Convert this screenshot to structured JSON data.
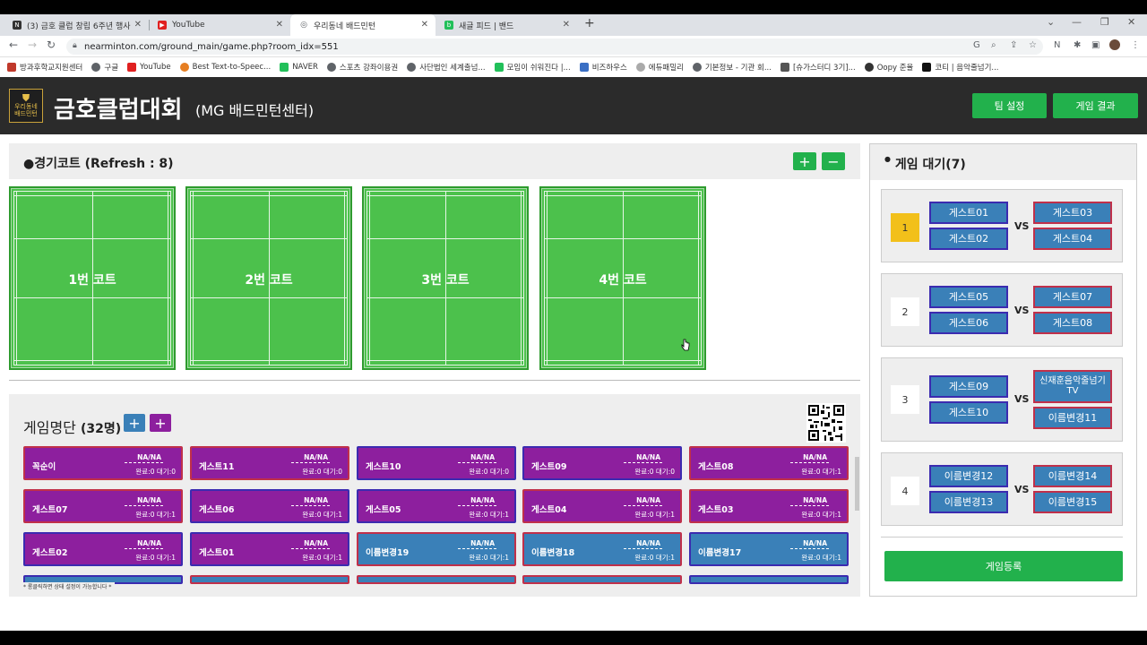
{
  "browser": {
    "tabs": [
      {
        "title": "(3) 금호 클럽 창립 6주년 행사",
        "color": "#333333",
        "glyph": "N"
      },
      {
        "title": "YouTube",
        "color": "#e02020",
        "glyph": "▶"
      },
      {
        "title": "우리동네 배드민턴",
        "color": "#5f6368",
        "glyph": "◎"
      },
      {
        "title": "새글 피드 | 밴드",
        "color": "#22c05a",
        "glyph": "b"
      }
    ],
    "url": "nearminton.com/ground_main/game.php?room_idx=551",
    "bookmarks": [
      {
        "label": "방과후학교지원센터",
        "color": "#c0392b"
      },
      {
        "label": "구글",
        "color": "#5f6368"
      },
      {
        "label": "YouTube",
        "color": "#e02020"
      },
      {
        "label": "Best Text-to-Speec...",
        "color": "#e67e22"
      },
      {
        "label": "NAVER",
        "color": "#22c05a"
      },
      {
        "label": "스포츠 강좌이용권",
        "color": "#5f6368"
      },
      {
        "label": "사단법인 세계출넘...",
        "color": "#5f6368"
      },
      {
        "label": "모임이 쉬워진다 |...",
        "color": "#22c05a"
      },
      {
        "label": "비즈하우스",
        "color": "#3a6fc4"
      },
      {
        "label": "에듀패밀리",
        "color": "#aaaaaa"
      },
      {
        "label": "기본정보 - 기관 회...",
        "color": "#5f6368"
      },
      {
        "label": "[슈가스터디 3기]...",
        "color": "#555555"
      },
      {
        "label": "Oopy 준율",
        "color": "#333333"
      },
      {
        "label": "코티 | 음악줄넘기...",
        "color": "#111111"
      }
    ]
  },
  "header": {
    "logo_line1": "우리동네",
    "logo_line2": "배드민턴",
    "title": "금호클럽대회",
    "subtitle": "(MG 배드민턴센터)",
    "team_settings": "팀 설정",
    "game_results": "게임 결과"
  },
  "courts_section": {
    "title": "●경기코트 (Refresh : 8)",
    "plus": "+",
    "minus": "−",
    "courts": [
      "1번 코트",
      "2번 코트",
      "3번 코트",
      "4번 코트"
    ]
  },
  "roster": {
    "title_prefix": "게임명단",
    "count": "(32명)",
    "plus": "+",
    "players": [
      {
        "name": "꼭순이",
        "na": "NA/NA",
        "stat": "완료:0  대기:0",
        "style": "purple"
      },
      {
        "name": "게스트11",
        "na": "NA/NA",
        "stat": "완료:0  대기:0",
        "style": "purple"
      },
      {
        "name": "게스트10",
        "na": "NA/NA",
        "stat": "완료:0  대기:0",
        "style": "purple2"
      },
      {
        "name": "게스트09",
        "na": "NA/NA",
        "stat": "완료:0  대기:0",
        "style": "purple2"
      },
      {
        "name": "게스트08",
        "na": "NA/NA",
        "stat": "완료:0  대기:1",
        "style": "purple"
      },
      {
        "name": "게스트07",
        "na": "NA/NA",
        "stat": "완료:0  대기:1",
        "style": "purple"
      },
      {
        "name": "게스트06",
        "na": "NA/NA",
        "stat": "완료:0  대기:1",
        "style": "purple2"
      },
      {
        "name": "게스트05",
        "na": "NA/NA",
        "stat": "완료:0  대기:1",
        "style": "purple2"
      },
      {
        "name": "게스트04",
        "na": "NA/NA",
        "stat": "완료:0  대기:1",
        "style": "purple"
      },
      {
        "name": "게스트03",
        "na": "NA/NA",
        "stat": "완료:0  대기:1",
        "style": "purple"
      },
      {
        "name": "게스트02",
        "na": "NA/NA",
        "stat": "완료:0  대기:1",
        "style": "purple2"
      },
      {
        "name": "게스트01",
        "na": "NA/NA",
        "stat": "완료:0  대기:1",
        "style": "purple2"
      },
      {
        "name": "이름변경19",
        "na": "NA/NA",
        "stat": "완료:0  대기:1",
        "style": "blue"
      },
      {
        "name": "이름변경18",
        "na": "NA/NA",
        "stat": "완료:0  대기:1",
        "style": "blue"
      },
      {
        "name": "이름변경17",
        "na": "NA/NA",
        "stat": "완료:0  대기:1",
        "style": "blue2"
      }
    ],
    "note": "* 롱클릭하면 상태 설정이 가능합니다 *"
  },
  "queue": {
    "title": "게임 대기(7)",
    "games": [
      {
        "num": "1",
        "active": true,
        "l1": "게스트01",
        "l2": "게스트02",
        "r1": "게스트03",
        "r2": "게스트04"
      },
      {
        "num": "2",
        "active": false,
        "l1": "게스트05",
        "l2": "게스트06",
        "r1": "게스트07",
        "r2": "게스트08"
      },
      {
        "num": "3",
        "active": false,
        "l1": "게스트09",
        "l2": "게스트10",
        "r1": "신재훈음악줄넘기TV",
        "r2": "이름변경11"
      },
      {
        "num": "4",
        "active": false,
        "l1": "이름변경12",
        "l2": "이름변경13",
        "r1": "이름변경14",
        "r2": "이름변경15"
      }
    ],
    "vs": "VS",
    "register": "게임등록"
  }
}
